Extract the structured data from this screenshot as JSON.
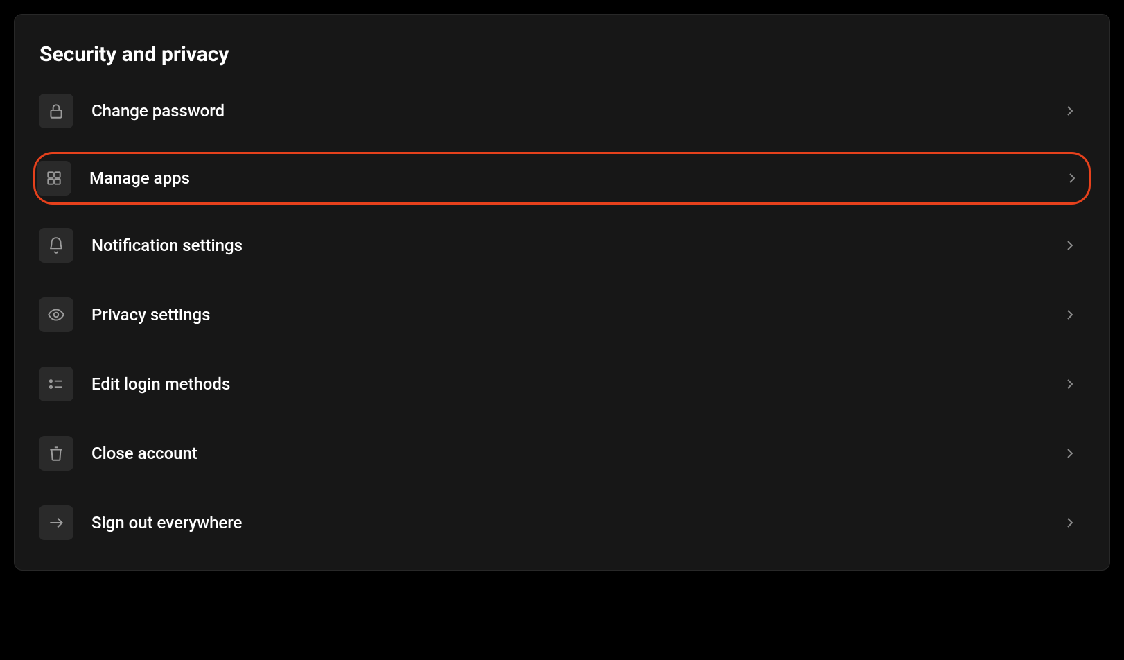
{
  "panel": {
    "title": "Security and privacy",
    "items": [
      {
        "label": "Change password",
        "icon": "lock-icon",
        "highlighted": false
      },
      {
        "label": "Manage apps",
        "icon": "grid-icon",
        "highlighted": true
      },
      {
        "label": "Notification settings",
        "icon": "bell-icon",
        "highlighted": false
      },
      {
        "label": "Privacy settings",
        "icon": "eye-icon",
        "highlighted": false
      },
      {
        "label": "Edit login methods",
        "icon": "list-icon",
        "highlighted": false
      },
      {
        "label": "Close account",
        "icon": "trash-icon",
        "highlighted": false
      },
      {
        "label": "Sign out everywhere",
        "icon": "arrow-right-icon",
        "highlighted": false
      }
    ]
  },
  "colors": {
    "highlight": "#e6411c",
    "panel_bg": "#171717",
    "icon_bg": "#2a2a2a"
  }
}
